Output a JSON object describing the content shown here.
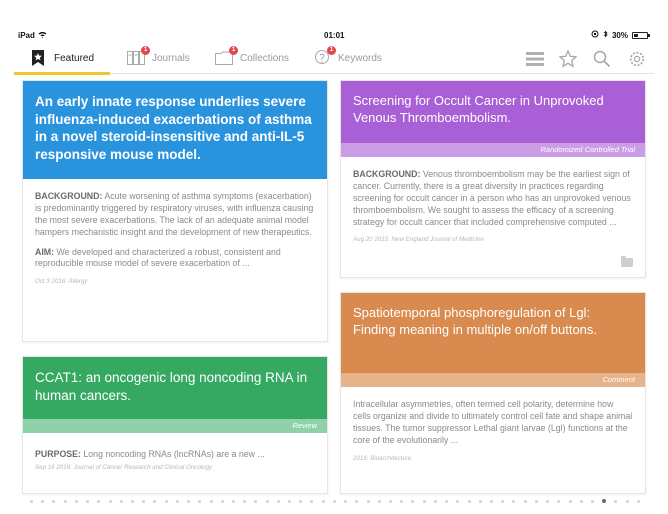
{
  "status_bar": {
    "device": "iPad",
    "time": "01:01",
    "battery": "30%"
  },
  "tabs": [
    {
      "label": "Featured",
      "active": true,
      "badge": null
    },
    {
      "label": "Journals",
      "active": false,
      "badge": "1"
    },
    {
      "label": "Collections",
      "active": false,
      "badge": "1"
    },
    {
      "label": "Keywords",
      "active": false,
      "badge": "1"
    }
  ],
  "toolbar": {
    "icons": [
      "list-icon",
      "star-icon",
      "search-icon",
      "gear-icon"
    ]
  },
  "colors": {
    "accent_yellow": "#f4c531",
    "card_blue": "#2a93dd",
    "card_purple": "#a95fd5",
    "card_green": "#35a862",
    "card_orange": "#d98a4e"
  },
  "cards": [
    {
      "title": "An early innate response underlies severe influenza-induced exacerbations of asthma in a novel steroid-insensitive and anti-IL-5 responsive mouse model.",
      "tag": "",
      "p1_label": "BACKGROUND:",
      "p1_text": " Acute worsening of asthma symptoms (exacerbation) is predominantly triggered by respiratory viruses, with influenza causing the most severe exacerbations. The lack of an adequate animal model hampers mechanistic insight and the development of new therapeutics.",
      "p2_label": "AIM:",
      "p2_text": " We developed and characterized a robust, consistent and reproducible mouse model of severe exacerbation of ...",
      "meta": "Oct 3 2016: Allergy"
    },
    {
      "title": "Screening for Occult Cancer in Unprovoked Venous Thromboembolism.",
      "tag": "Randomized Controlled Trial",
      "p1_label": "BACKGROUND:",
      "p1_text": " Venous thromboembolism may be the earliest sign of cancer. Currently, there is a great diversity in practices regarding screening for occult cancer in a person who has an unprovoked venous thromboembolism. We sought to assess the efficacy of a screening strategy for occult cancer that included comprehensive computed ...",
      "meta": "Aug 20 2015: New England Journal of Medicine"
    },
    {
      "title": "Spatiotemporal phosphoregulation of Lgl: Finding meaning in multiple on/off buttons.",
      "tag": "Comment",
      "p1_text": "Intracellular asymmetries, often termed cell polarity, determine how cells organize and divide to ultimately control cell fate and shape animal tissues. The tumor suppressor Lethal giant larvae (Lgl) functions at the core of the evolutionarily ...",
      "meta": "2016: Bioarchitecture"
    },
    {
      "title": "CCAT1: an oncogenic long noncoding RNA in human cancers.",
      "tag": "Review",
      "p1_label": "PURPOSE:",
      "p1_text": " Long noncoding RNAs (lncRNAs) are a new ...",
      "meta": "Sep 16 2016: Journal of Cancer Research and Clinical Oncology"
    }
  ],
  "pagination": {
    "total": 55,
    "current": 51
  }
}
